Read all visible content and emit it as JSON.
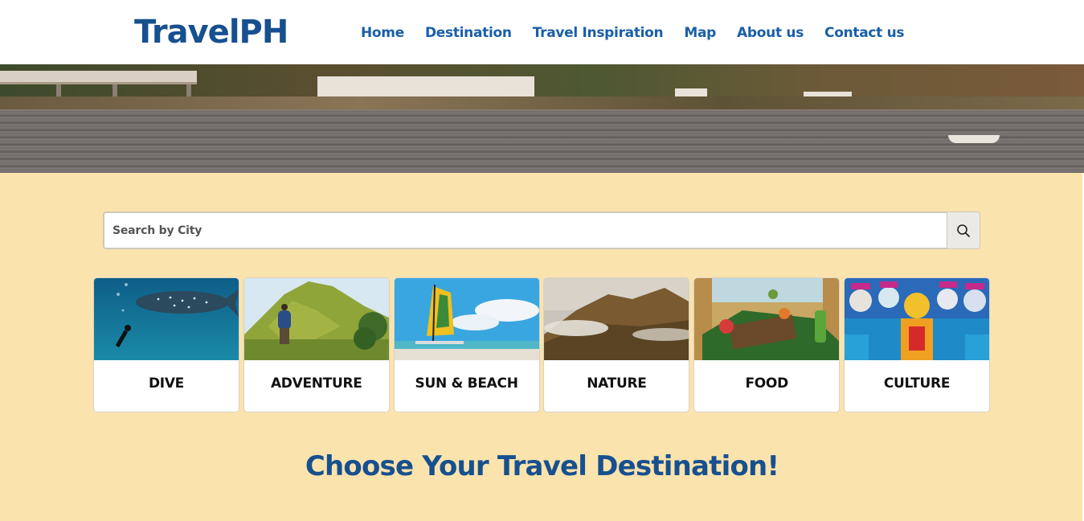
{
  "brand": {
    "logo": "TravelPH",
    "color": "#17508f"
  },
  "nav": {
    "items": [
      {
        "label": "Home"
      },
      {
        "label": "Destination"
      },
      {
        "label": "Travel Inspiration"
      },
      {
        "label": "Map"
      },
      {
        "label": "About us"
      },
      {
        "label": "Contact us"
      }
    ]
  },
  "search": {
    "placeholder": "Search by City",
    "value": "",
    "icon": "search-icon"
  },
  "categories": [
    {
      "label": "DIVE",
      "image": "whale-shark-diver"
    },
    {
      "label": "ADVENTURE",
      "image": "hiker-mountain"
    },
    {
      "label": "SUN & BEACH",
      "image": "paraw-sailboat-beach"
    },
    {
      "label": "NATURE",
      "image": "chocolate-hills"
    },
    {
      "label": "FOOD",
      "image": "boodle-feast"
    },
    {
      "label": "CULTURE",
      "image": "masskara-festival"
    }
  ],
  "main": {
    "headline": "Choose Your Travel Destination!"
  },
  "colors": {
    "content_bg": "#fbe3ad",
    "nav_link": "#1a5fa8"
  }
}
